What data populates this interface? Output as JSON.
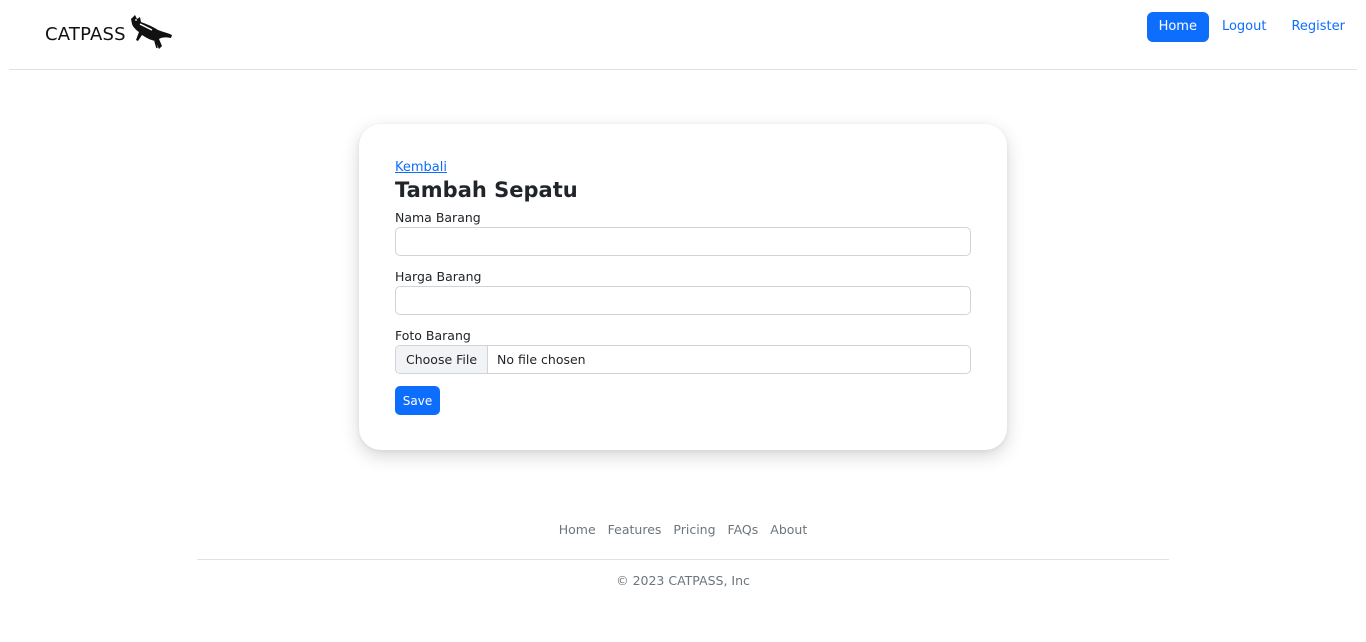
{
  "header": {
    "brand": "CATPASS",
    "nav": [
      {
        "label": "Home",
        "active": true
      },
      {
        "label": "Logout",
        "active": false
      },
      {
        "label": "Register",
        "active": false
      }
    ]
  },
  "card": {
    "back_link": "Kembali",
    "title": "Tambah Sepatu",
    "fields": {
      "nama_label": "Nama Barang",
      "nama_value": "",
      "harga_label": "Harga Barang",
      "harga_value": "",
      "foto_label": "Foto Barang",
      "file_button": "Choose File",
      "file_status": "No file chosen"
    },
    "save_label": "Save"
  },
  "footer": {
    "links": [
      "Home",
      "Features",
      "Pricing",
      "FAQs",
      "About"
    ],
    "copyright": "© 2023 CATPASS, Inc"
  },
  "colors": {
    "primary": "#0d6efd",
    "muted": "#6c757d",
    "border": "#dee2e6"
  }
}
